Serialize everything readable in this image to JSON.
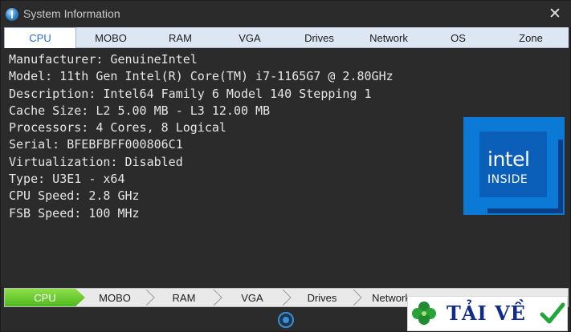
{
  "window": {
    "title": "System Information",
    "close_glyph": "✕"
  },
  "tabs": [
    {
      "label": "CPU",
      "active": true
    },
    {
      "label": "MOBO",
      "active": false
    },
    {
      "label": "RAM",
      "active": false
    },
    {
      "label": "VGA",
      "active": false
    },
    {
      "label": "Drives",
      "active": false
    },
    {
      "label": "Network",
      "active": false
    },
    {
      "label": "OS",
      "active": false
    },
    {
      "label": "Zone",
      "active": false
    }
  ],
  "cpu_info": [
    "Manufacturer: GenuineIntel",
    "Model: 11th Gen Intel(R) Core(TM) i7-1165G7 @ 2.80GHz",
    "Description: Intel64 Family 6 Model 140 Stepping 1",
    "Cache Size: L2 5.00 MB - L3 12.00 MB",
    "Processors: 4 Cores, 8 Logical",
    "Serial: BFEBFBFF000806C1",
    "Virtualization: Disabled",
    "Type: U3E1 - x64",
    "CPU Speed: 2.8 GHz",
    "FSB Speed: 100 MHz"
  ],
  "badge": {
    "word": "intel",
    "sub": "INSIDE",
    "color": "#0a7ad6"
  },
  "bottom_nav": [
    {
      "label": "CPU",
      "active": true
    },
    {
      "label": "MOBO",
      "active": false
    },
    {
      "label": "RAM",
      "active": false
    },
    {
      "label": "VGA",
      "active": false
    },
    {
      "label": "Drives",
      "active": false
    },
    {
      "label": "Network",
      "active": false
    }
  ],
  "watermark": {
    "text": "TẢI VỀ",
    "color": "#0f2b8c"
  },
  "colors": {
    "accent": "#2a6ed0",
    "active_crumb": "#6ccb2f",
    "background": "#2b2b2b"
  }
}
